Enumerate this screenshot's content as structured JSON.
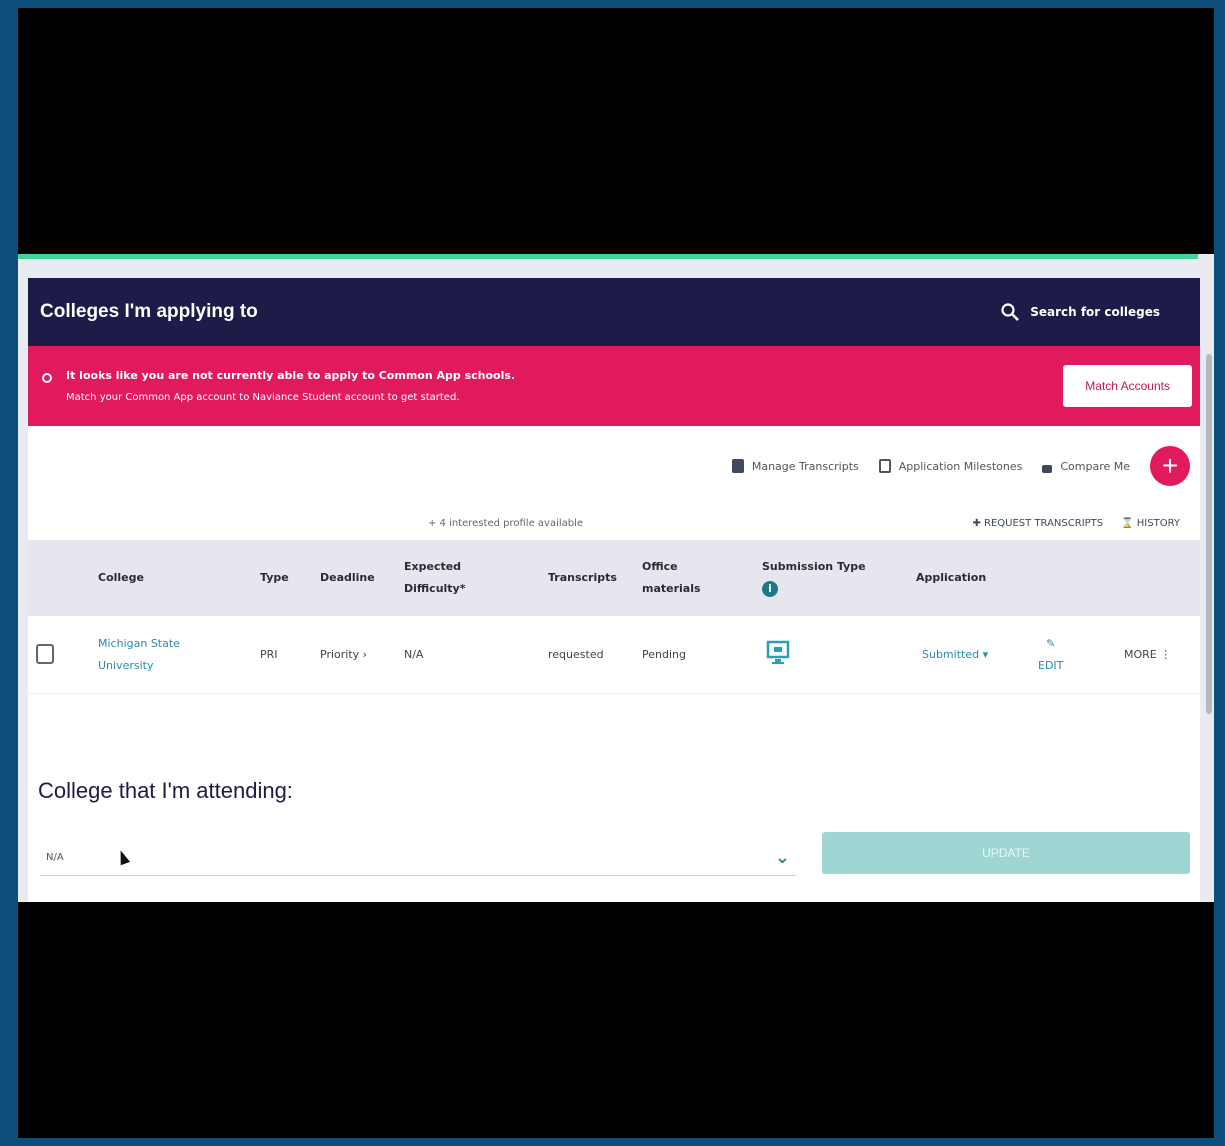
{
  "header": {
    "title": "Colleges I'm applying to",
    "search_label": "Search for colleges"
  },
  "alert": {
    "line1": "It looks like you are not currently able to apply to Common App schools.",
    "line2": "Match your Common App account to Naviance Student account to get started.",
    "button": "Match Accounts"
  },
  "toolbar": {
    "manage_transcripts": "Manage Transcripts",
    "milestones": "Application Milestones",
    "compare": "Compare Me"
  },
  "subbar": {
    "profile_note": "+ 4 interested profile available",
    "request_transcripts": "REQUEST TRANSCRIPTS",
    "history": "HISTORY"
  },
  "table": {
    "headers": {
      "college": "College",
      "type": "Type",
      "deadline": "Deadline",
      "expected_1": "Expected",
      "expected_2": "Difficulty*",
      "transcripts": "Transcripts",
      "office_1": "Office",
      "office_2": "materials",
      "submission": "Submission Type",
      "application": "Application"
    },
    "rows": [
      {
        "college_1": "Michigan State",
        "college_2": "University",
        "type": "PRI",
        "deadline": "Priority",
        "difficulty": "N/A",
        "transcripts": "requested",
        "office": "Pending",
        "application": "Submitted",
        "edit": "EDIT",
        "more": "MORE"
      }
    ]
  },
  "attending": {
    "title": "College that I'm attending:",
    "selected": "N/A",
    "update": "UPDATE"
  },
  "colors": {
    "header_bg": "#1d1b47",
    "alert_bg": "#e01a5b",
    "accent_green": "#3fd49a",
    "link": "#2a8bb0"
  }
}
